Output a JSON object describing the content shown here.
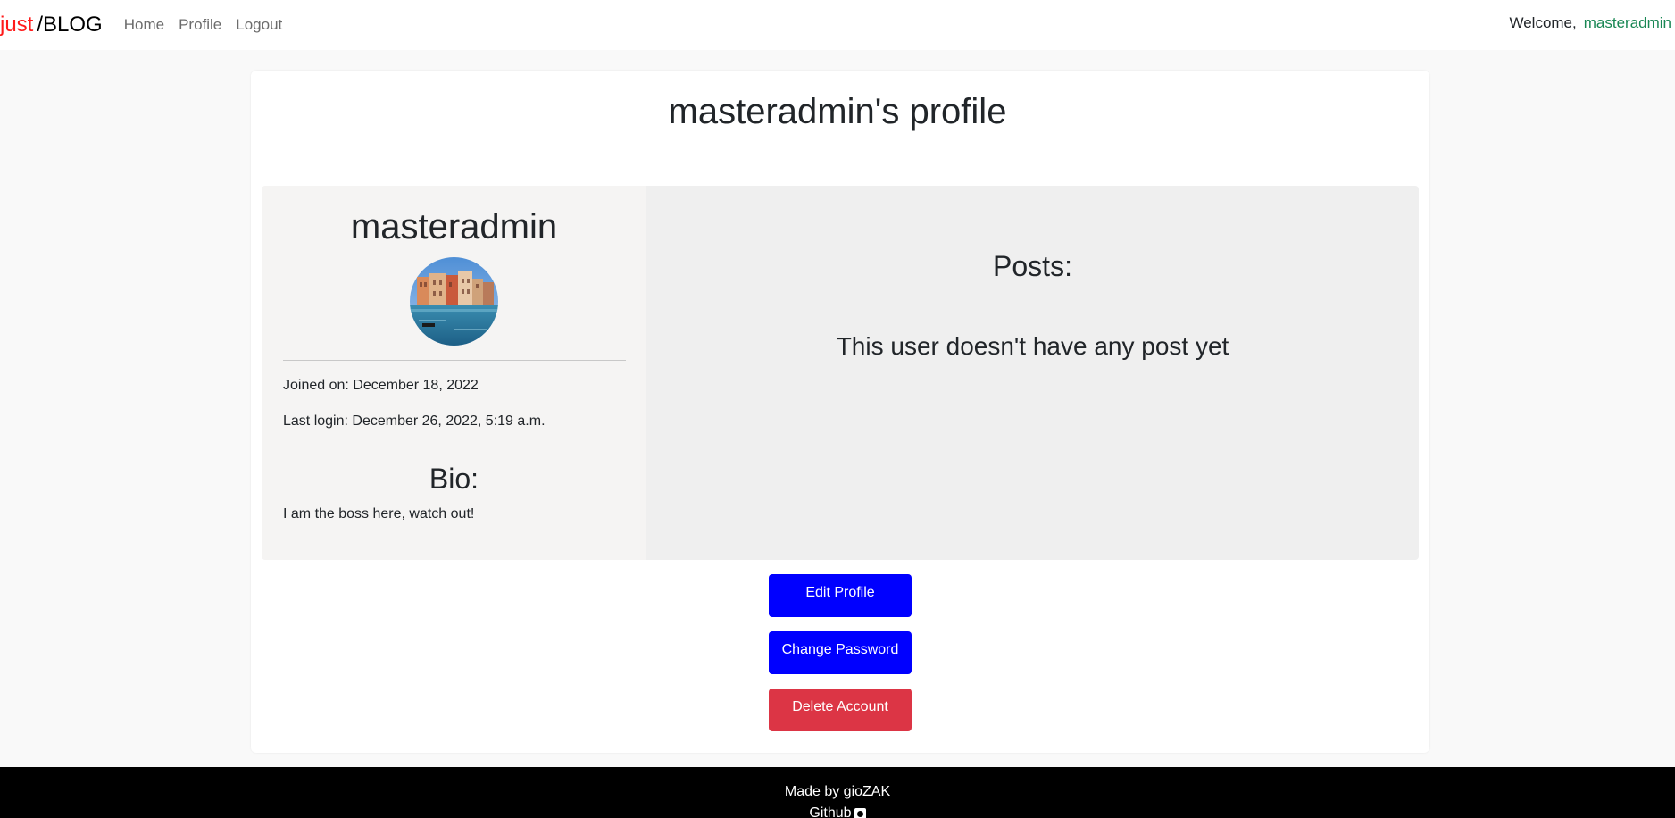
{
  "navbar": {
    "brand_part1": "just",
    "brand_part2": "/BLOG",
    "links": [
      {
        "label": "Home"
      },
      {
        "label": "Profile"
      },
      {
        "label": "Logout"
      }
    ],
    "welcome_label": "Welcome,",
    "welcome_user": "masteradmin"
  },
  "profile": {
    "page_title": "masteradmin's profile",
    "username": "masteradmin",
    "avatar_icon": "venice-canal-photo",
    "joined": "Joined on: December 18, 2022",
    "last_login": "Last login: December 26, 2022, 5:19 a.m.",
    "bio_title": "Bio:",
    "bio_text": "I am the boss here, watch out!"
  },
  "posts": {
    "title": "Posts:",
    "empty_message": "This user doesn't have any post yet"
  },
  "actions": {
    "edit_label": "Edit Profile",
    "change_password_label": "Change Password",
    "delete_label": "Delete Account"
  },
  "footer": {
    "made_by": "Made by gioZAK",
    "github_label": "Github",
    "github_icon": "github-icon"
  },
  "colors": {
    "brand_red": "#ff1a1a",
    "user_green": "#198754",
    "primary_blue": "#0000ff",
    "danger_red": "#dc3545"
  }
}
